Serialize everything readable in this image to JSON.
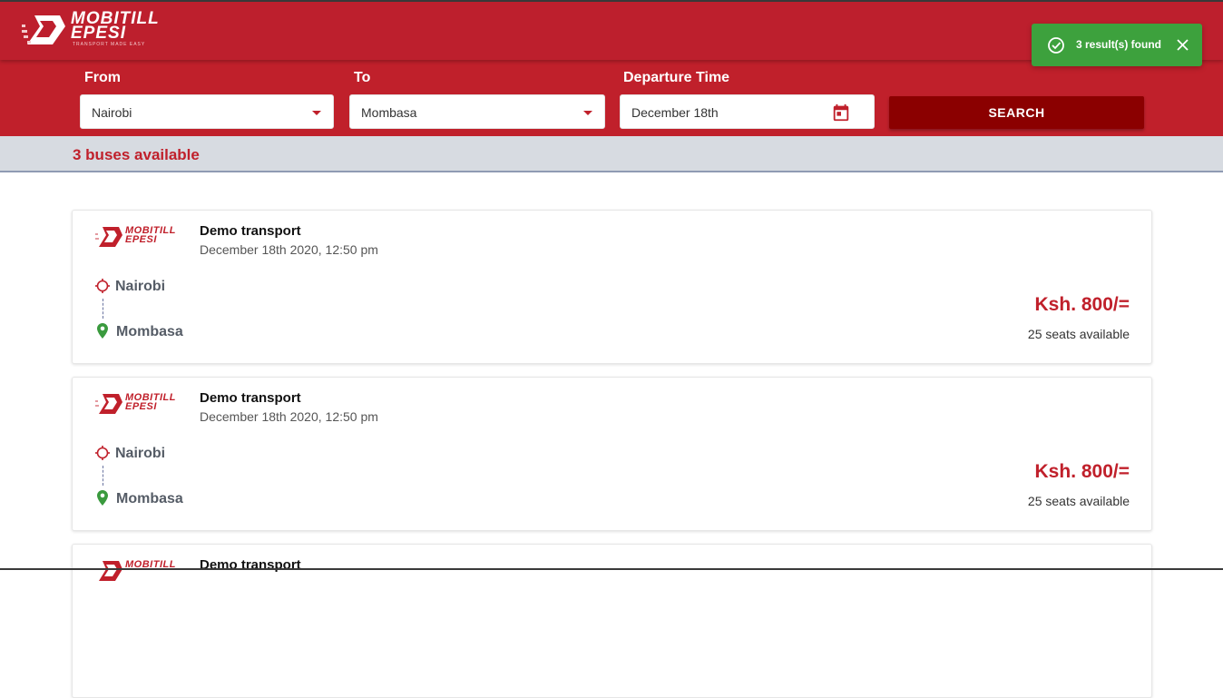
{
  "header": {
    "logo_name_line1": "MOBITILL",
    "logo_name_line2": "EPESI",
    "logo_tagline": "TRANSPORT MADE EASY",
    "brand_color": "#c0202b"
  },
  "search": {
    "from_label": "From",
    "from_value": "Nairobi",
    "to_label": "To",
    "to_value": "Mombasa",
    "departure_label": "Departure Time",
    "departure_value": "December 18th",
    "search_button": "SEARCH"
  },
  "toast": {
    "message": "3 result(s) found",
    "icon": "check-circle-icon",
    "close_icon": "close-icon",
    "color": "#3da13d"
  },
  "results": {
    "count_text": "3 buses available",
    "buses": [
      {
        "company": "Demo transport",
        "datetime": "December 18th 2020, 12:50 pm",
        "from": "Nairobi",
        "to": "Mombasa",
        "price": "Ksh. 800/=",
        "seats": "25 seats available"
      },
      {
        "company": "Demo transport",
        "datetime": "December 18th 2020, 12:50 pm",
        "from": "Nairobi",
        "to": "Mombasa",
        "price": "Ksh. 800/=",
        "seats": "25 seats available"
      },
      {
        "company": "Demo transport",
        "datetime": "",
        "from": "",
        "to": "",
        "price": "",
        "seats": ""
      }
    ]
  }
}
